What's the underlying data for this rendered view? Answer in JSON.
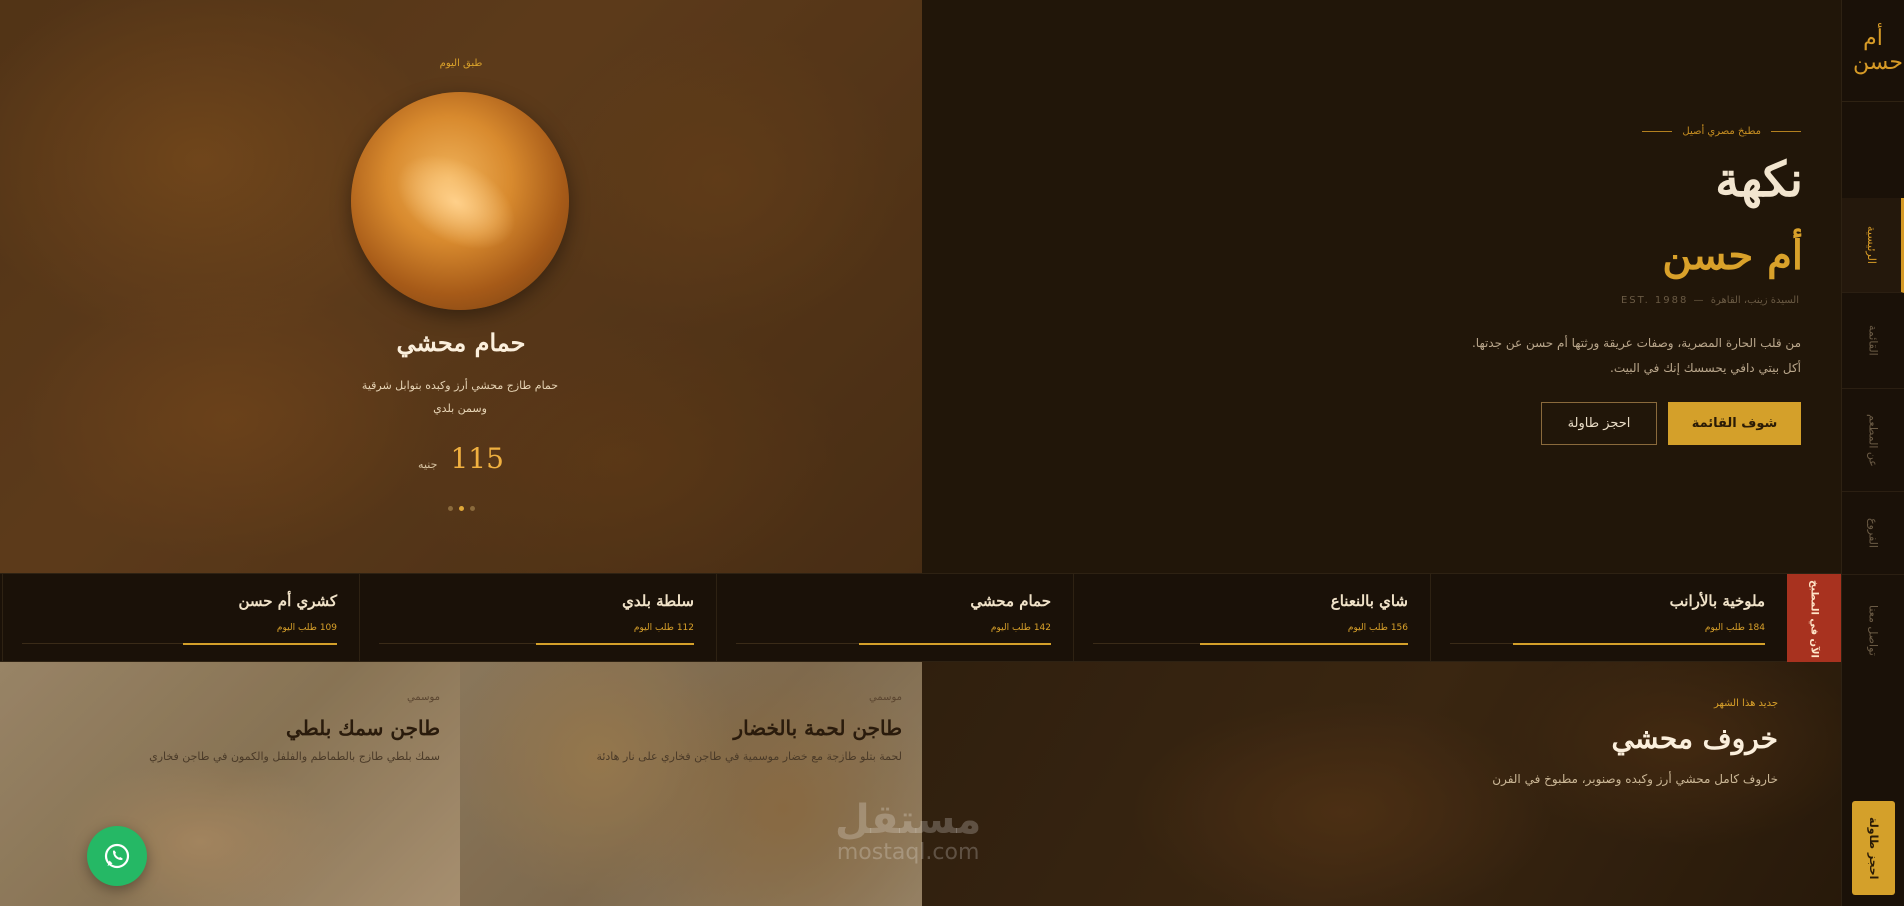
{
  "brand": {
    "logo": "أم حسن"
  },
  "nav": {
    "items": [
      {
        "label": "الرئيسية",
        "active": true
      },
      {
        "label": "القائمة",
        "active": false
      },
      {
        "label": "عن المطعم",
        "active": false
      },
      {
        "label": "الفروع",
        "active": false
      },
      {
        "label": "تواصل معنا",
        "active": false
      }
    ],
    "book_label": "احجز طاولة"
  },
  "hero": {
    "kicker": "مطبخ مصري أصيل",
    "title_line1": "نكهة",
    "title_line2": "أم حسن",
    "est": "EST. 1988 — السيدة زينب، القاهرة",
    "intro": "من قلب الحارة المصرية، وصفات عريقة ورثتها أم حسن عن جدتها. أكل بيتي دافي يحسسك إنك في البيت.",
    "primary_button": "شوف القائمة",
    "secondary_button": "احجز طاولة"
  },
  "dish_of_day": {
    "kicker": "طبق اليوم",
    "name": "حمام محشي",
    "description": "حمام طازج محشي أرز وكبده بتوابل شرقية وسمن بلدي",
    "price": "115",
    "currency": "جنيه",
    "slides": 3,
    "active_slide": 2
  },
  "popular": {
    "tag": "الآن في المطبخ",
    "items": [
      {
        "name": "ملوخية بالأرانب",
        "count": "184 طلب اليوم",
        "level": 0.8
      },
      {
        "name": "شاي بالنعناع",
        "count": "156 طلب اليوم",
        "level": 0.66
      },
      {
        "name": "حمام محشي",
        "count": "142 طلب اليوم",
        "level": 0.61
      },
      {
        "name": "سلطة بلدي",
        "count": "112 طلب اليوم",
        "level": 0.5
      },
      {
        "name": "كشري أم حسن",
        "count": "109 طلب اليوم",
        "level": 0.49
      }
    ]
  },
  "featured": [
    {
      "tag": "جديد هذا الشهر",
      "title": "خروف محشي",
      "description": "خاروف كامل محشي أرز وكبده وصنوبر، مطبوخ في الفرن"
    },
    {
      "tag": "موسمي",
      "title": "طاجن لحمة بالخضار",
      "description": "لحمة بتلو طازجة مع خضار موسمية في طاجن فخاري على نار هادئة"
    },
    {
      "tag": "موسمي",
      "title": "طاجن سمك بلطي",
      "description": "سمك بلطي طازج بالطماطم والفلفل والكمون في طاجن فخاري"
    }
  ],
  "watermark": {
    "arabic": "مستقل",
    "latin": "mostaql.com"
  },
  "colors": {
    "accent": "#d4a02a",
    "background": "#1e1409",
    "alert": "#a8321f",
    "whatsapp": "#25b865"
  },
  "icons": {
    "whatsapp": "whatsapp-icon"
  }
}
